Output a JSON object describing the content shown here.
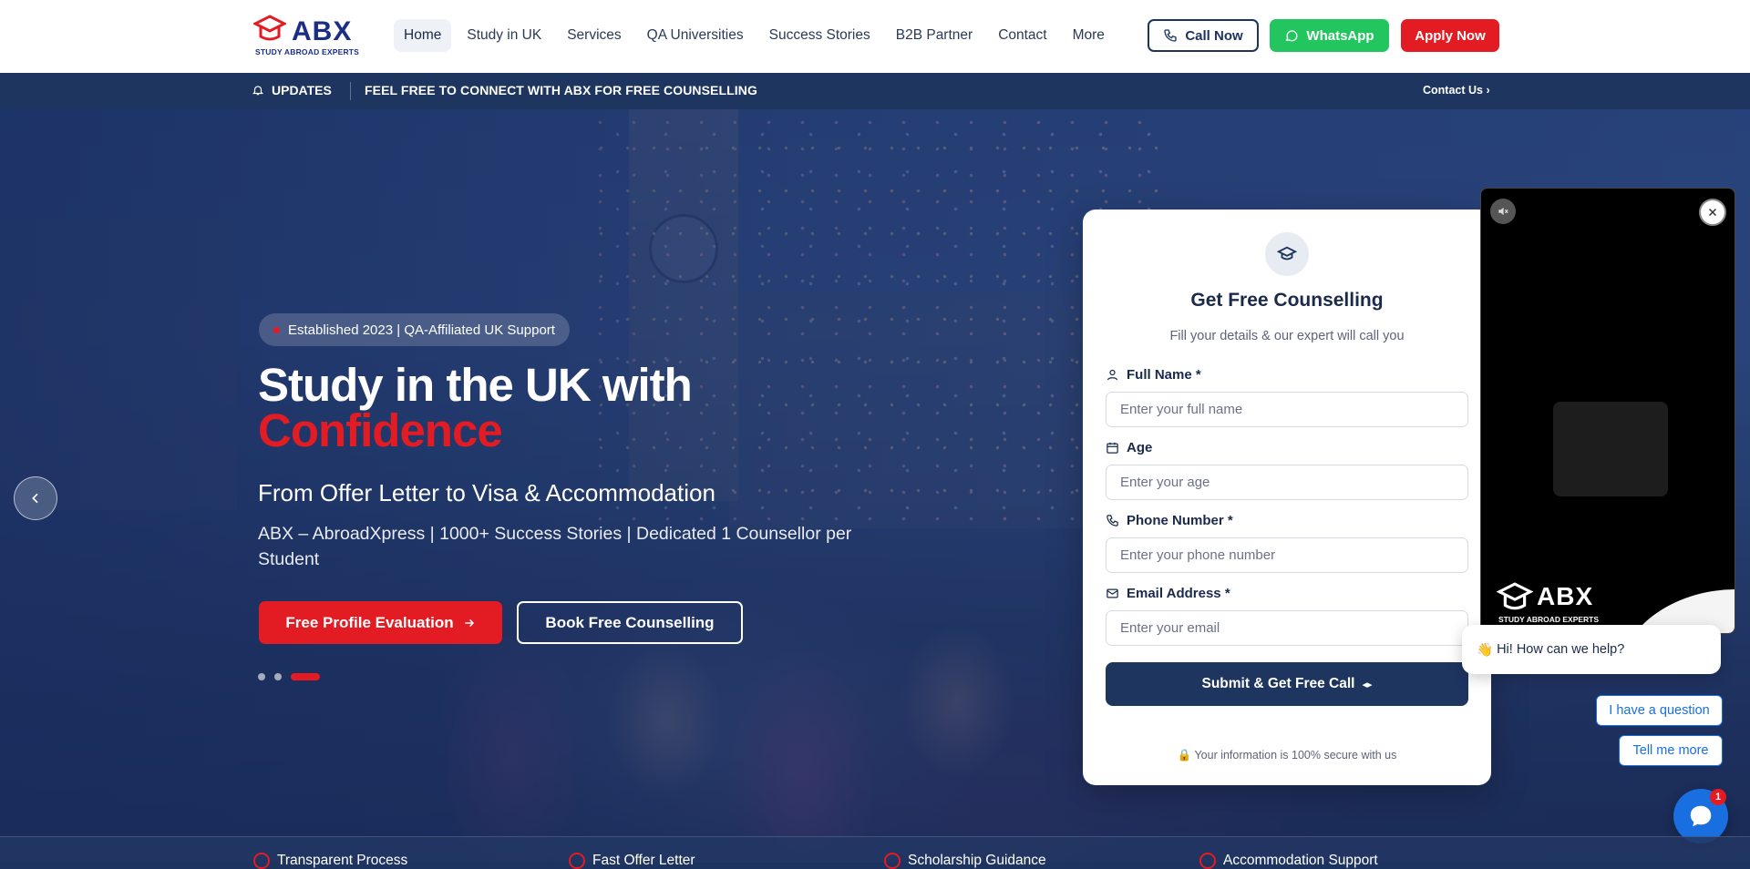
{
  "brand": {
    "name": "ABX",
    "tagline": "STUDY ABROAD EXPERTS"
  },
  "nav": {
    "items": [
      "Home",
      "Study in UK",
      "Services",
      "QA Universities",
      "Success Stories",
      "B2B Partner",
      "Contact",
      "More"
    ],
    "active": "Home"
  },
  "header_buttons": {
    "call": "Call Now",
    "whatsapp": "WhatsApp",
    "apply": "Apply Now"
  },
  "updates": {
    "label": "UPDATES",
    "message_prefix": "FEEL FREE TO CONNECT WITH ABX FOR ",
    "message_bold": "FREE COUNSELLING",
    "contact": "Contact Us"
  },
  "hero": {
    "pill": "Established 2023 | QA-Affiliated UK Support",
    "title_line1": "Study in the UK with",
    "title_accent": "Confidence",
    "subtitle": "From Offer Letter to Visa & Accommodation",
    "description": "ABX – AbroadXpress | 1000+ Success Stories | Dedicated 1 Counsellor per Student",
    "cta_primary": "Free Profile Evaluation",
    "cta_secondary": "Book Free Counselling",
    "slide_count": 3,
    "active_slide": 3
  },
  "form": {
    "title": "Get Free Counselling",
    "subtitle": "Fill your details & our expert will call you",
    "fields": [
      {
        "label": "Full Name *",
        "placeholder": "Enter your full name",
        "icon": "user-icon"
      },
      {
        "label": "Age",
        "placeholder": "Enter your age",
        "icon": "calendar-icon"
      },
      {
        "label": "Phone Number *",
        "placeholder": "Enter your phone number",
        "icon": "phone-icon"
      },
      {
        "label": "Email Address *",
        "placeholder": "Enter your email",
        "icon": "mail-icon"
      }
    ],
    "submit": "Submit & Get Free Call",
    "secure": "Your information is 100% secure with us"
  },
  "video_widget": {
    "brand": "ABX",
    "tagline": "STUDY ABROAD EXPERTS"
  },
  "chat": {
    "greeting": "Hi! How can we help?",
    "options": [
      "I have a question",
      "Tell me more"
    ],
    "unread": "1"
  },
  "features": [
    "Transparent Process",
    "Fast Offer Letter",
    "Scholarship Guidance",
    "Accommodation Support"
  ],
  "colors": {
    "navy": "#1e3560",
    "red": "#e31b23",
    "green": "#22c55e",
    "blue": "#1a6fe0"
  }
}
